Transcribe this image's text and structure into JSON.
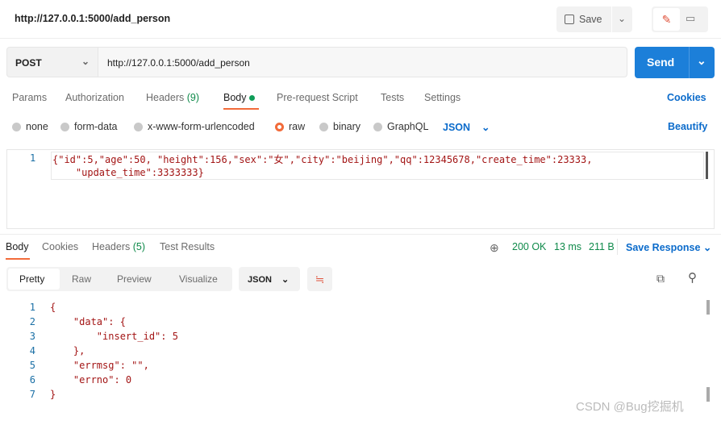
{
  "header": {
    "title": "http://127.0.0.1:5000/add_person",
    "save_label": "Save"
  },
  "request": {
    "method": "POST",
    "url": "http://127.0.0.1:5000/add_person",
    "send_label": "Send"
  },
  "tabs": [
    {
      "label": "Params"
    },
    {
      "label": "Authorization"
    },
    {
      "label": "Headers",
      "count": "(9)"
    },
    {
      "label": "Body"
    },
    {
      "label": "Pre-request Script"
    },
    {
      "label": "Tests"
    },
    {
      "label": "Settings"
    }
  ],
  "cookies_label": "Cookies",
  "body_types": [
    "none",
    "form-data",
    "x-www-form-urlencoded",
    "raw",
    "binary",
    "GraphQL"
  ],
  "body_selected": "raw",
  "format": "JSON",
  "beautify_label": "Beautify",
  "editor": {
    "line_number": "1",
    "line1": "{\"id\":5,\"age\":50, \"height\":156,\"sex\":\"女\",\"city\":\"beijing\",\"qq\":12345678,\"create_time\":23333,",
    "line2": "    \"update_time\":3333333}"
  },
  "response": {
    "tabs": [
      {
        "label": "Body"
      },
      {
        "label": "Cookies"
      },
      {
        "label": "Headers",
        "count": "(5)"
      },
      {
        "label": "Test Results"
      }
    ],
    "status": "200 OK",
    "time": "13 ms",
    "size": "211 B",
    "save_label": "Save Response",
    "views": [
      "Pretty",
      "Raw",
      "Preview",
      "Visualize"
    ],
    "format": "JSON",
    "lines": [
      {
        "n": "1",
        "t": "{"
      },
      {
        "n": "2",
        "t": "    \"data\": {"
      },
      {
        "n": "3",
        "t": "        \"insert_id\": 5"
      },
      {
        "n": "4",
        "t": "    },"
      },
      {
        "n": "5",
        "t": "    \"errmsg\": \"\","
      },
      {
        "n": "6",
        "t": "    \"errno\": 0"
      },
      {
        "n": "7",
        "t": "}"
      }
    ]
  },
  "watermark": "CSDN @Bug挖掘机"
}
